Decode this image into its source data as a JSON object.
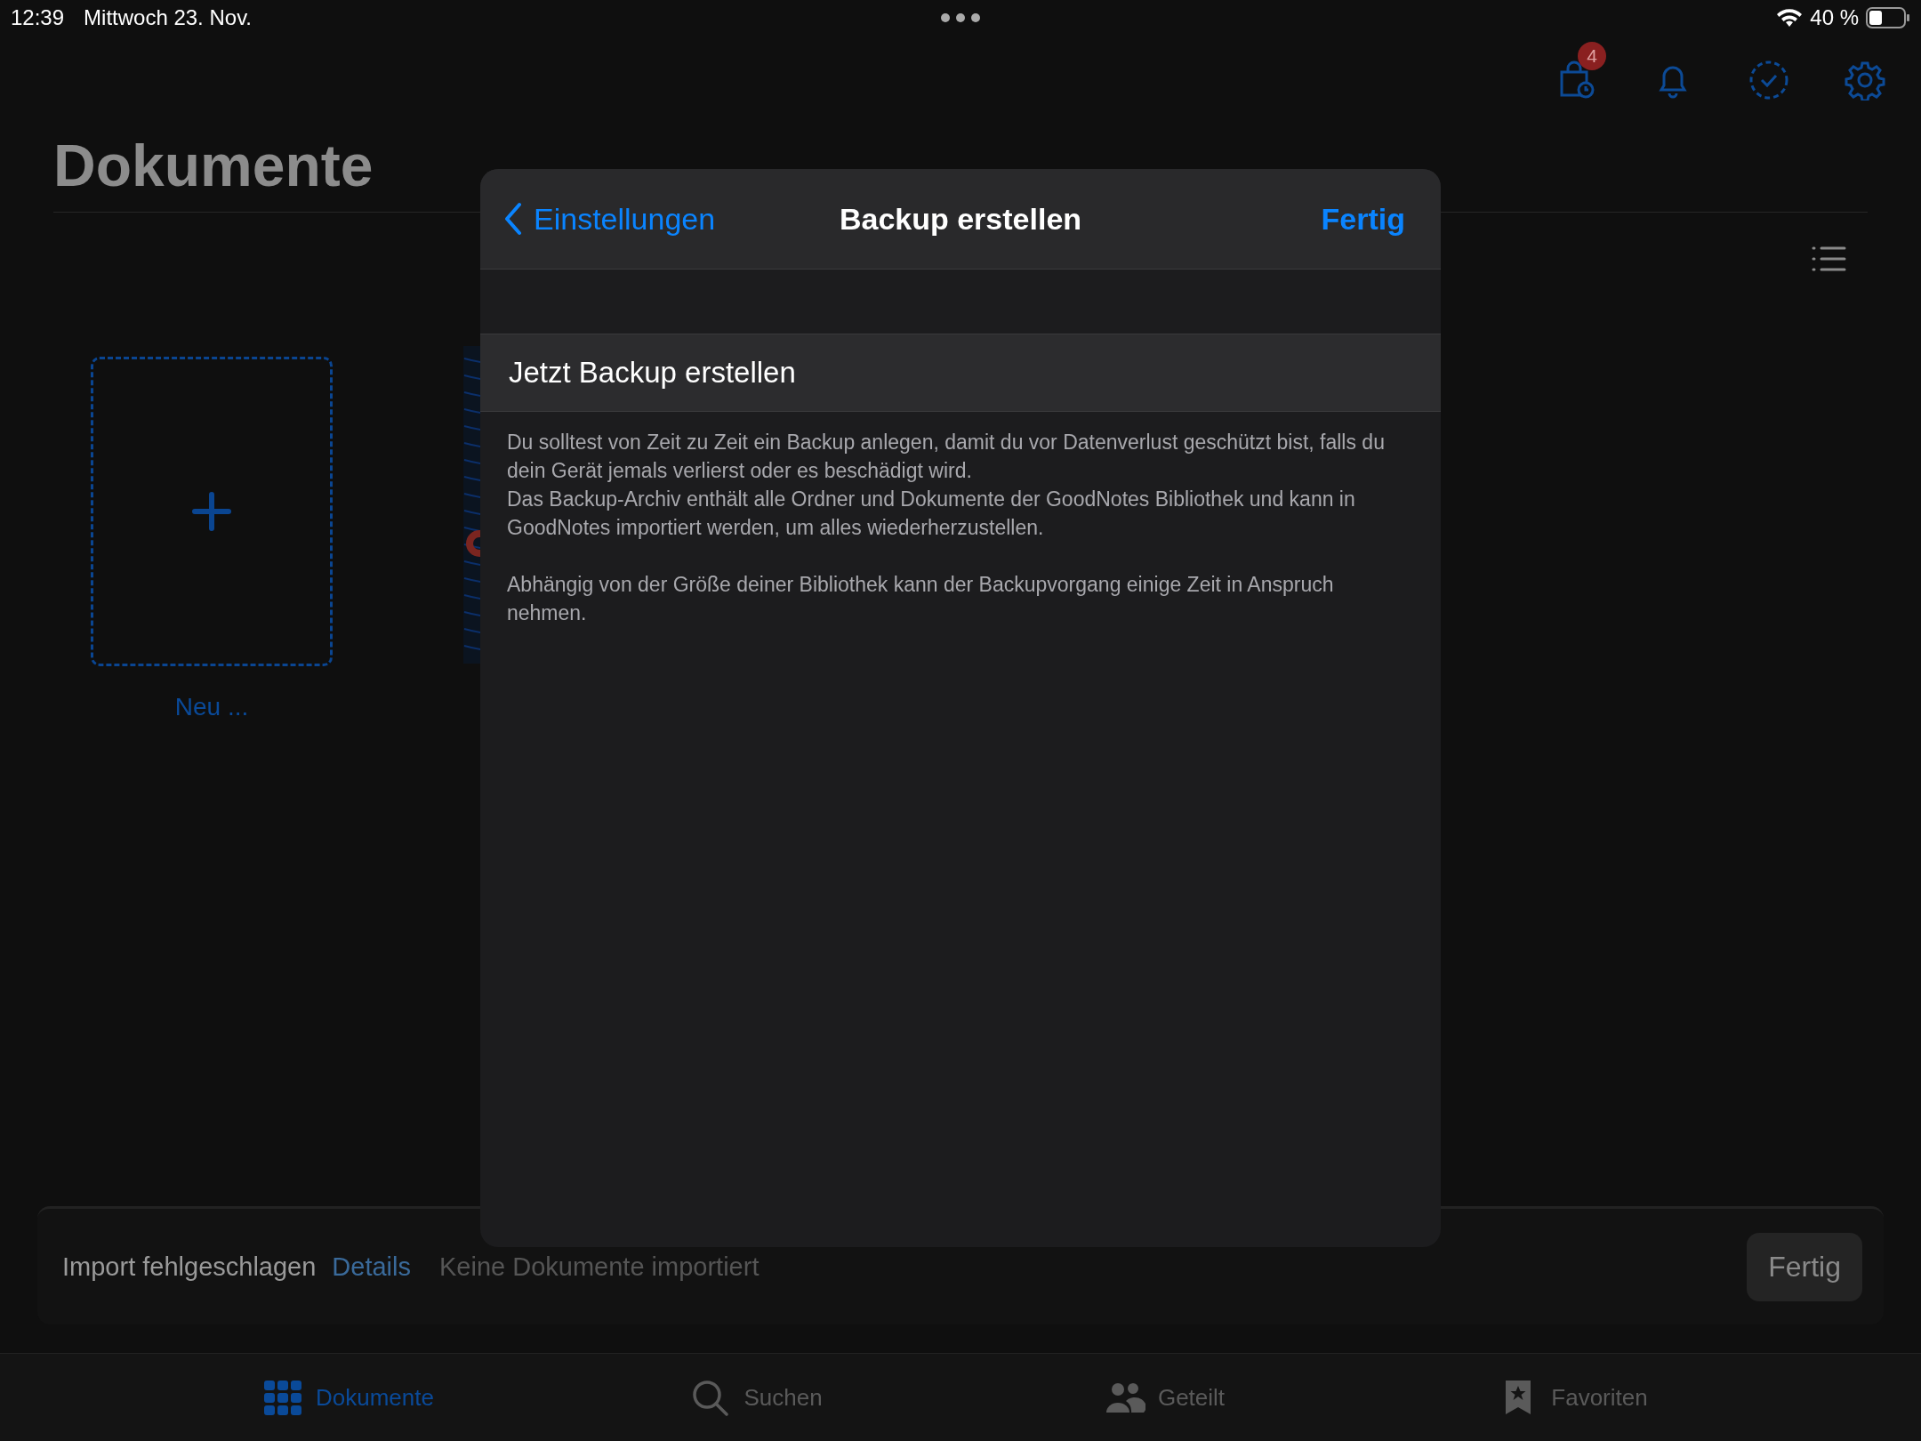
{
  "status_bar": {
    "time": "12:39",
    "date": "Mittwoch 23. Nov.",
    "battery": "40 %"
  },
  "toolbar": {
    "badge": "4"
  },
  "page_title": "Dokumente",
  "new_document": {
    "label": "Neu ..."
  },
  "modal": {
    "back": "Einstellungen",
    "title": "Backup erstellen",
    "done": "Fertig",
    "action": "Jetzt Backup erstellen",
    "paragraphs": [
      {
        "lines": [
          "Du solltest von Zeit zu Zeit ein Backup anlegen, damit du vor Datenverlust geschützt bist, falls du dein Gerät jemals verlierst oder es beschädigt wird.",
          "Das Backup-Archiv enthält alle Ordner und Dokumente der GoodNotes Bibliothek und kann in GoodNotes importiert werden, um alles wiederherzustellen."
        ]
      },
      {
        "lines": [
          "Abhängig von der Größe deiner Bibliothek kann der Backupvorgang einige Zeit in Anspruch nehmen."
        ]
      }
    ]
  },
  "toast": {
    "message": "Import fehlgeschlagen",
    "link": "Details",
    "detail": "Keine Dokumente importiert",
    "button": "Fertig"
  },
  "tabs": [
    {
      "label": "Dokumente",
      "selected": true
    },
    {
      "label": "Suchen",
      "selected": false
    },
    {
      "label": "Geteilt",
      "selected": false
    },
    {
      "label": "Favoriten",
      "selected": false
    }
  ]
}
